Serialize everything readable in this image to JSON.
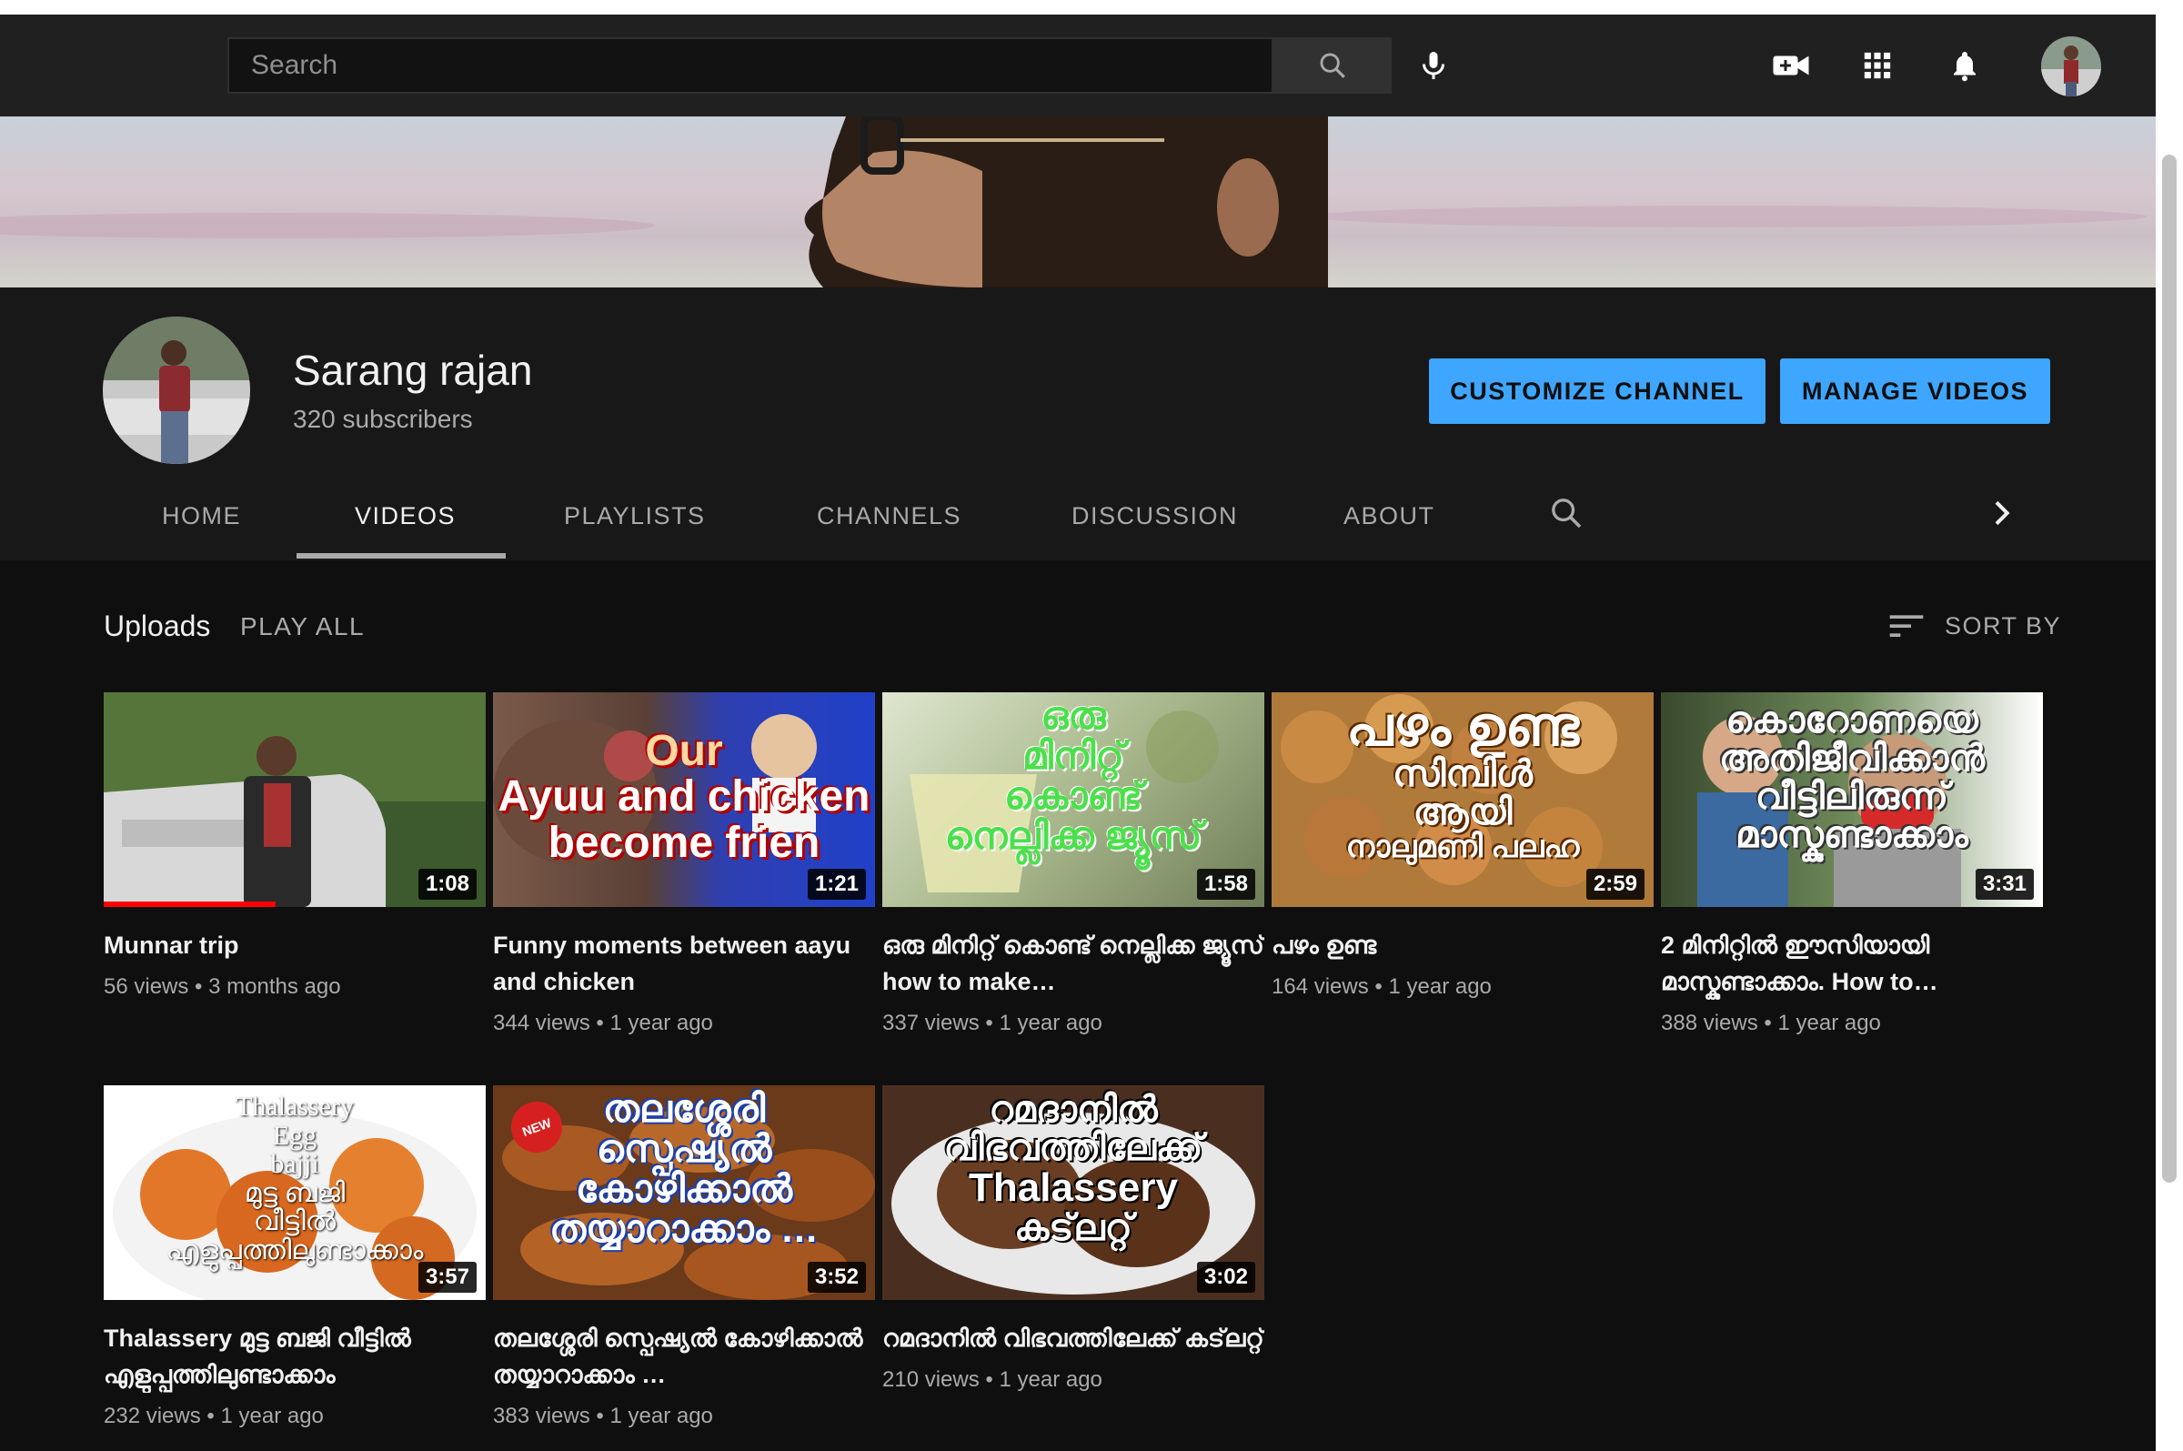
{
  "header": {
    "search_placeholder": "Search"
  },
  "channel": {
    "name": "Sarang rajan",
    "subscribers": "320 subscribers",
    "customize_label": "CUSTOMIZE CHANNEL",
    "manage_label": "MANAGE VIDEOS"
  },
  "tabs": [
    {
      "label": "HOME"
    },
    {
      "label": "VIDEOS"
    },
    {
      "label": "PLAYLISTS"
    },
    {
      "label": "CHANNELS"
    },
    {
      "label": "DISCUSSION"
    },
    {
      "label": "ABOUT"
    }
  ],
  "uploads": {
    "label": "Uploads",
    "play_all": "PLAY ALL",
    "sort_by": "SORT BY"
  },
  "videos": [
    {
      "title": "Munnar trip",
      "views": "56 views",
      "age": "3 months ago",
      "duration": "1:08",
      "progress": 0.45
    },
    {
      "title": "Funny moments between aayu and chicken",
      "views": "344 views",
      "age": "1 year ago",
      "duration": "1:21",
      "thumb_text": [
        "Our",
        "Ayuu and chicken",
        "become frien"
      ]
    },
    {
      "title": "ഒരു മിനിറ്റ് കൊണ്ട് നെല്ലിക്ക ജ്യൂസ് how to make…",
      "views": "337 views",
      "age": "1 year ago",
      "duration": "1:58",
      "thumb_text": [
        "ഒരു",
        "മിനിറ്റ്",
        "കൊണ്ട്",
        "നെല്ലിക്ക ജ്യൂസ്"
      ]
    },
    {
      "title": "പഴം ഉണ്ട",
      "views": "164 views",
      "age": "1 year ago",
      "duration": "2:59",
      "thumb_text": [
        "പഴം ഉണ്ട",
        "സിമ്പിൾ",
        "ആയി",
        "നാലുമണി പലഹ"
      ]
    },
    {
      "title": "2 മിനിറ്റിൽ ഈസിയായി മാസ്കുണ്ടാക്കാം. How to…",
      "views": "388 views",
      "age": "1 year ago",
      "duration": "3:31",
      "thumb_text": [
        "കൊറോണയെ",
        "അതിജീവിക്കാൻ",
        "വീട്ടിലിരുന്ന്",
        "മാസ്കുണ്ടാക്കാം"
      ]
    },
    {
      "title": "Thalassery മുട്ട ബജി വീട്ടിൽ എളുപ്പത്തിലുണ്ടാക്കാം",
      "views": "232 views",
      "age": "1 year ago",
      "duration": "3:57",
      "thumb_text": [
        "Thalassery",
        "Egg",
        "bajji",
        "മുട്ട ബജി",
        "വീട്ടിൽ",
        "എളുപ്പത്തിലുണ്ടാക്കാം"
      ]
    },
    {
      "title": "തലശ്ശേരി സ്പെഷ്യൽ കോഴിക്കാൽ തയ്യാറാക്കാം …",
      "views": "383 views",
      "age": "1 year ago",
      "duration": "3:52",
      "thumb_text": [
        "തലശ്ശേരി",
        "സ്പെഷ്യൽ",
        "കോഴിക്കാൽ",
        "തയ്യാറാക്കാം …"
      ],
      "badge": "NEW"
    },
    {
      "title": "റമദാനിൽ വിഭവത്തിലേക്ക് കട്‌ലറ്റ്",
      "views": "210 views",
      "age": "1 year ago",
      "duration": "3:02",
      "thumb_text": [
        "റമദാനിൽ",
        "വിഭവത്തിലേക്ക്",
        "Thalassery",
        "കട്‌ലറ്റ്"
      ]
    }
  ],
  "colors": {
    "accent": "#3ea6ff",
    "background": "#0f0f0f",
    "header": "#202020",
    "channel_bg": "#181818"
  }
}
